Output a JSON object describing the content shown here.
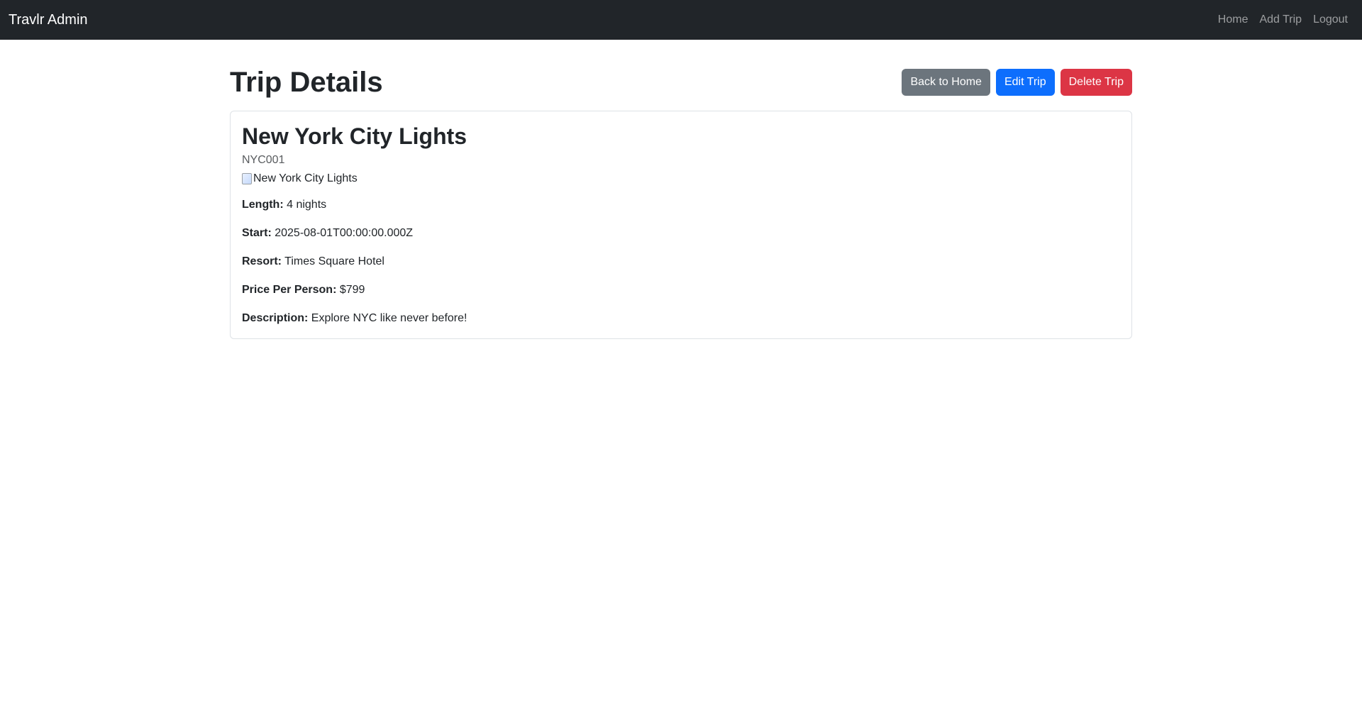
{
  "navbar": {
    "brand": "Travlr Admin",
    "links": [
      "Home",
      "Add Trip",
      "Logout"
    ]
  },
  "page": {
    "title": "Trip Details",
    "buttons": {
      "back": "Back to Home",
      "edit": "Edit Trip",
      "delete": "Delete Trip"
    }
  },
  "trip": {
    "name": "New York City Lights",
    "code": "NYC001",
    "image_alt": "New York City Lights",
    "details": [
      {
        "label": "Length:",
        "value": "4 nights"
      },
      {
        "label": "Start:",
        "value": "2025-08-01T00:00:00.000Z"
      },
      {
        "label": "Resort:",
        "value": "Times Square Hotel"
      },
      {
        "label": "Price Per Person:",
        "value": "$799"
      },
      {
        "label": "Description:",
        "value": "Explore NYC like never before!"
      }
    ]
  },
  "colors": {
    "navbar_bg": "#212529",
    "secondary": "#6c757d",
    "primary": "#0d6efd",
    "danger": "#dc3545"
  },
  "icons": {
    "broken_image": "broken-image-icon"
  }
}
